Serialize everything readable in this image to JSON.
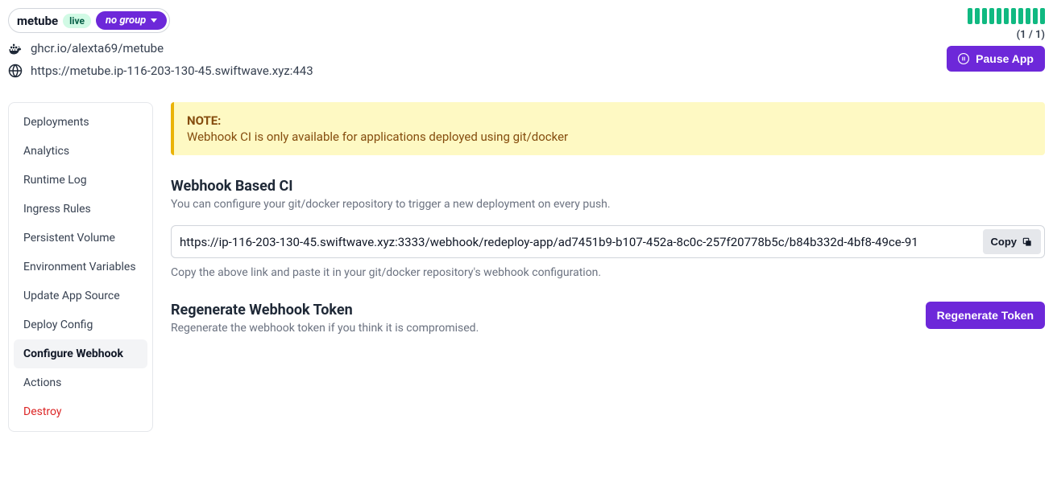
{
  "header": {
    "app_name": "metube",
    "live_label": "live",
    "group_label": "no group",
    "image": "ghcr.io/alexta69/metube",
    "url": "https://metube.ip-116-203-130-45.swiftwave.xyz:443",
    "replica_count": "(1 / 1)",
    "pause_label": "Pause App"
  },
  "sidebar": {
    "items": [
      {
        "label": "Deployments",
        "active": false
      },
      {
        "label": "Analytics",
        "active": false
      },
      {
        "label": "Runtime Log",
        "active": false
      },
      {
        "label": "Ingress Rules",
        "active": false
      },
      {
        "label": "Persistent Volume",
        "active": false
      },
      {
        "label": "Environment Variables",
        "active": false
      },
      {
        "label": "Update App Source",
        "active": false
      },
      {
        "label": "Deploy Config",
        "active": false
      },
      {
        "label": "Configure Webhook",
        "active": true
      },
      {
        "label": "Actions",
        "active": false
      },
      {
        "label": "Destroy",
        "active": false,
        "danger": true
      }
    ]
  },
  "note": {
    "title": "NOTE:",
    "body": "Webhook CI is only available for applications deployed using git/docker"
  },
  "webhook": {
    "title": "Webhook Based CI",
    "sub": "You can configure your git/docker repository to trigger a new deployment on every push.",
    "url": "https://ip-116-203-130-45.swiftwave.xyz:3333/webhook/redeploy-app/ad7451b9-b107-452a-8c0c-257f20778b5c/b84b332d-4bf8-49ce-91",
    "copy_label": "Copy",
    "hint": "Copy the above link and paste it in your git/docker repository's webhook configuration."
  },
  "regen": {
    "title": "Regenerate Webhook Token",
    "sub": "Regenerate the webhook token if you think it is compromised.",
    "button_label": "Regenerate Token"
  }
}
